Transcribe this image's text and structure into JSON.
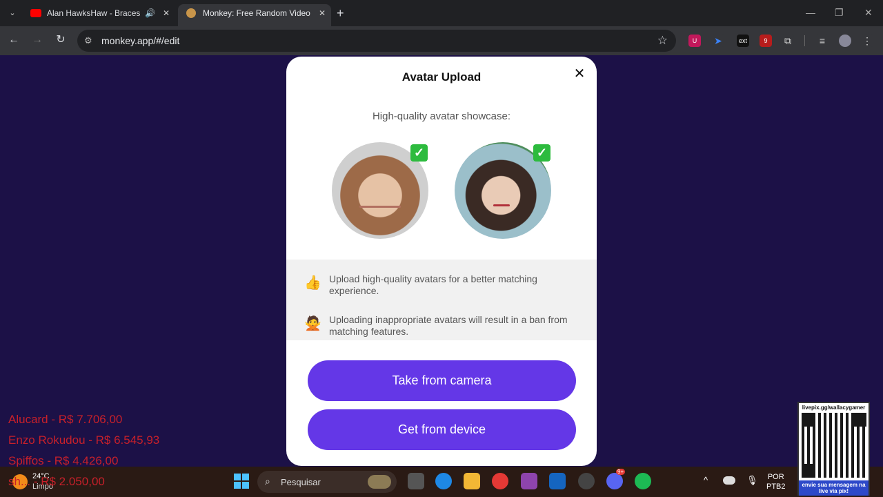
{
  "browser": {
    "tabs": [
      {
        "title": "Alan HawksHaw - Braces an",
        "favicon": "youtube-icon",
        "audio": true
      },
      {
        "title": "Monkey: Free Random Video C",
        "favicon": "monkey-icon",
        "active": true
      }
    ],
    "url": "monkey.app/#/edit",
    "extension_badges": {
      "ext_label": "ext",
      "count_badge": "9"
    }
  },
  "modal": {
    "title": "Avatar Upload",
    "showcase_label": "High-quality avatar showcase:",
    "tips": [
      {
        "icon": "thumbs-up-icon",
        "text": "Upload high-quality avatars for a better matching experience."
      },
      {
        "icon": "no-entry-person-icon",
        "text": "Uploading inappropriate avatars will result in a ban from matching features."
      }
    ],
    "buttons": {
      "camera": "Take from camera",
      "device": "Get from device"
    },
    "accent_color": "#6437e7"
  },
  "overlay": {
    "donations": [
      "Alucard - R$ 7.706,00",
      "Enzo Rokudou - R$ 6.545,93",
      "Spiffos - R$ 4.426,00",
      "sh... - R$ 2.050,00"
    ],
    "qr": {
      "top_text": "livepix.gg/wallacygamer",
      "bottom_text": "envie sua mensagem na live via pix!"
    }
  },
  "taskbar": {
    "weather": {
      "temp": "24°C",
      "desc": "Limpo"
    },
    "search_placeholder": "Pesquisar",
    "lang": {
      "line1": "POR",
      "line2": "PTB2"
    },
    "discord_badge": "9+"
  }
}
